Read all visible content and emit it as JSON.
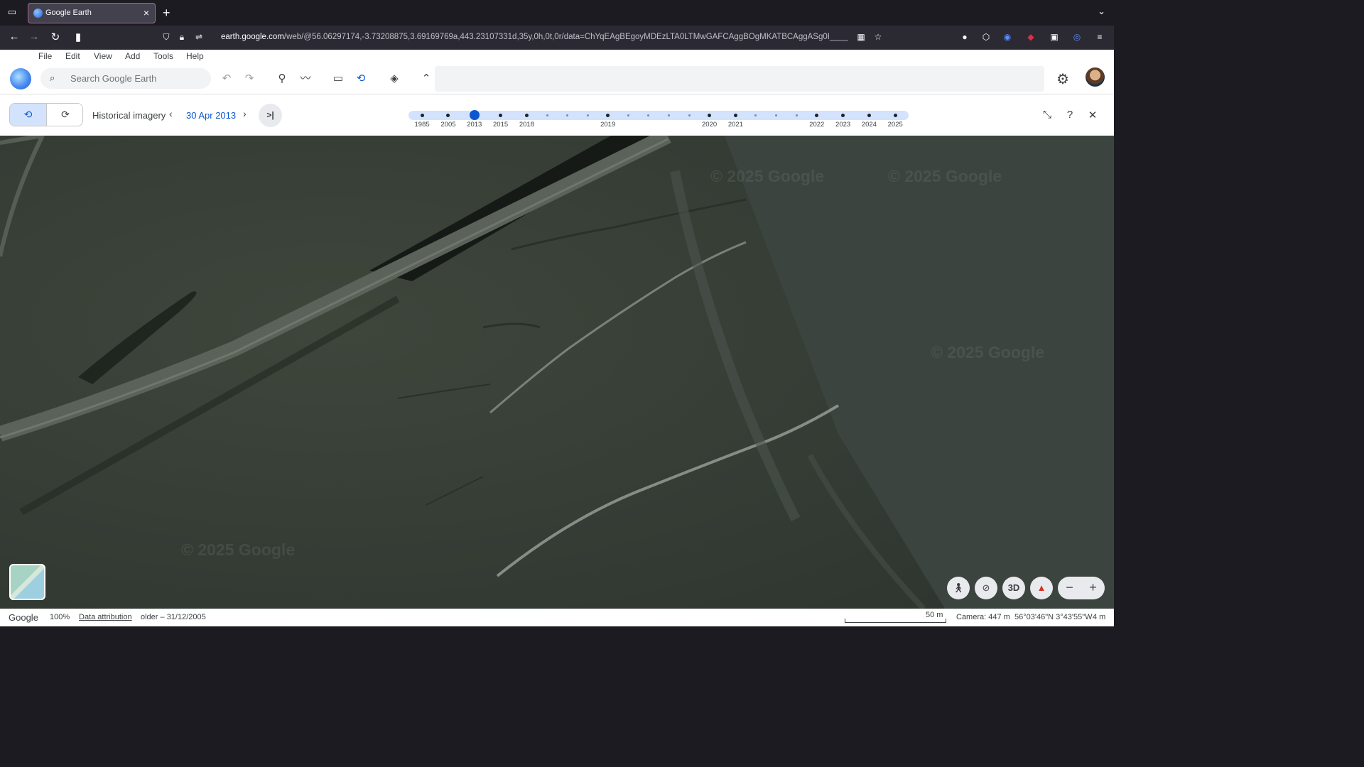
{
  "browser": {
    "tab_title": "Google Earth",
    "url_domain": "earth.google.com",
    "url_path": "/web/@56.06297174,-3.73208875,3.69169769a,443.23107331d,35y,0h,0t,0r/data=ChYqEAgBEgoyMDEzLTA0LTMwGAFCAggBOgMKATBCAggASg0I____"
  },
  "menu": {
    "file": "File",
    "edit": "Edit",
    "view": "View",
    "add": "Add",
    "tools": "Tools",
    "help": "Help"
  },
  "toolbar": {
    "search_placeholder": "Search Google Earth"
  },
  "historical": {
    "label": "Historical imagery",
    "date": "30 Apr 2013",
    "timeline": [
      {
        "label": "1985",
        "pos": 0.0271,
        "major": true
      },
      {
        "label": "2005",
        "pos": 0.0795,
        "major": true
      },
      {
        "label": "2013",
        "pos": 0.1318,
        "major": true,
        "selected": true
      },
      {
        "label": "2015",
        "pos": 0.1841,
        "major": true
      },
      {
        "label": "2018",
        "pos": 0.2364,
        "major": true
      },
      {
        "label": "",
        "pos": 0.277,
        "major": false
      },
      {
        "label": "",
        "pos": 0.3176,
        "major": false
      },
      {
        "label": "",
        "pos": 0.3582,
        "major": false
      },
      {
        "label": "2019",
        "pos": 0.3987,
        "major": true
      },
      {
        "label": "",
        "pos": 0.4393,
        "major": false
      },
      {
        "label": "",
        "pos": 0.48,
        "major": false
      },
      {
        "label": "",
        "pos": 0.5206,
        "major": false
      },
      {
        "label": "",
        "pos": 0.5612,
        "major": false
      },
      {
        "label": "2020",
        "pos": 0.6017,
        "major": true
      },
      {
        "label": "2021",
        "pos": 0.654,
        "major": true
      },
      {
        "label": "",
        "pos": 0.6946,
        "major": false
      },
      {
        "label": "",
        "pos": 0.7352,
        "major": false
      },
      {
        "label": "",
        "pos": 0.7758,
        "major": false
      },
      {
        "label": "2022",
        "pos": 0.8164,
        "major": true
      },
      {
        "label": "2023",
        "pos": 0.8688,
        "major": true
      },
      {
        "label": "2024",
        "pos": 0.921,
        "major": true
      },
      {
        "label": "2025",
        "pos": 0.9733,
        "major": true
      }
    ]
  },
  "map": {
    "watermark": "© 2025 Google",
    "mode_3d": "3D"
  },
  "status": {
    "brand": "Google",
    "zoom": "100%",
    "attribution": "Data attribution",
    "imagery_date": "older – 31/12/2005",
    "scale": "50 m",
    "camera": "Camera: 447 m",
    "coords": "56°03'46\"N 3°43'55\"W",
    "elevation": "4 m"
  }
}
